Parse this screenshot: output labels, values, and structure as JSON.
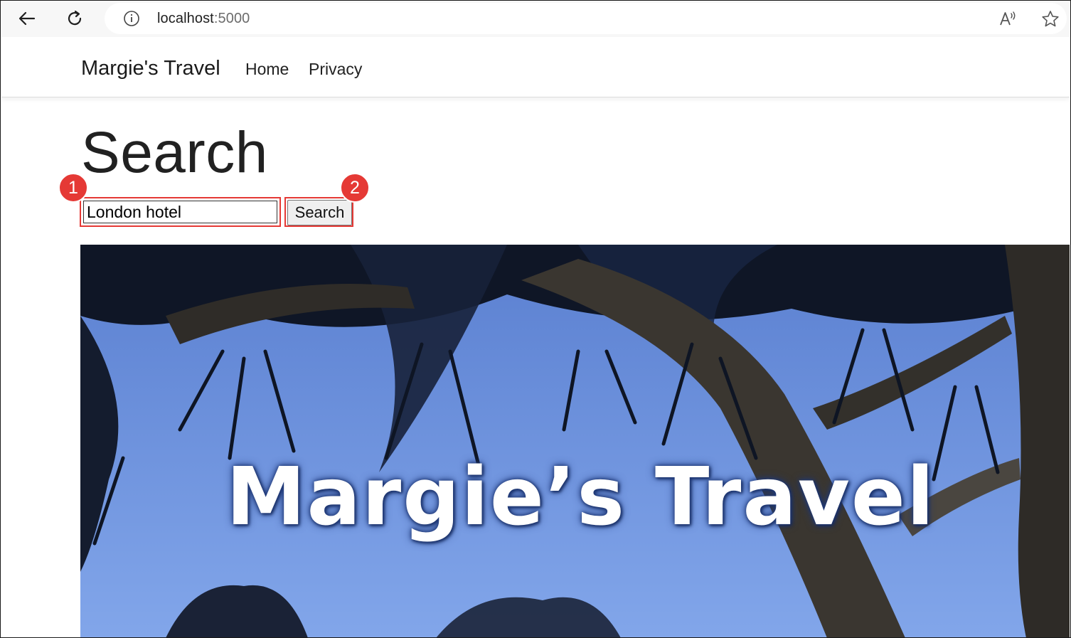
{
  "browser": {
    "url_host": "localhost",
    "url_port": ":5000"
  },
  "navbar": {
    "brand": "Margie's Travel",
    "links": [
      "Home",
      "Privacy"
    ]
  },
  "page": {
    "title": "Search",
    "search_value": "London hotel",
    "search_button": "Search",
    "hero_text": "Margie’s Travel"
  },
  "annotations": {
    "step1": "1",
    "step2": "2",
    "color": "#e53935"
  },
  "icons": [
    "back-arrow-icon",
    "reload-icon",
    "info-icon",
    "read-aloud-icon",
    "favorite-star-icon"
  ]
}
